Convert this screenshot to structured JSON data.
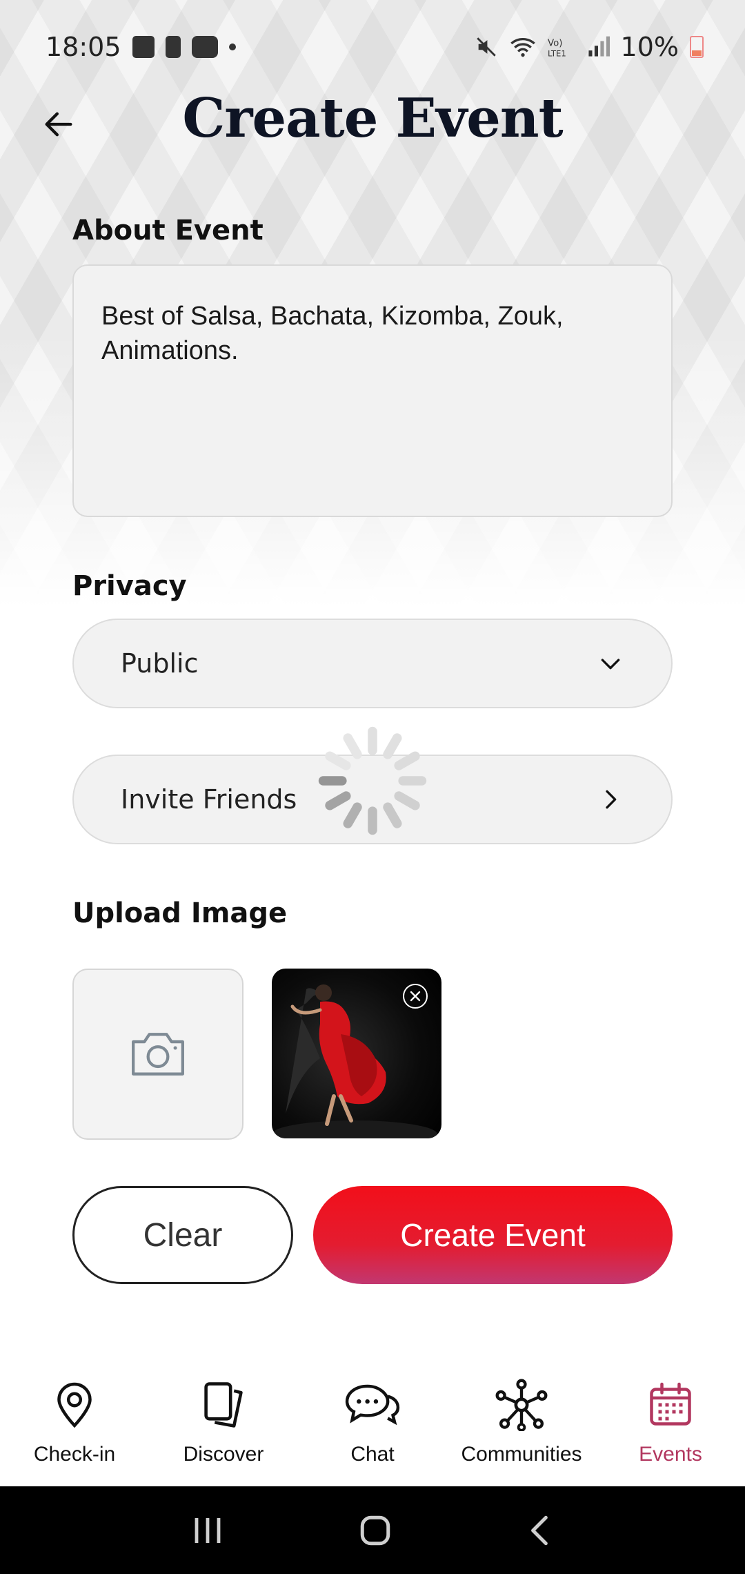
{
  "status": {
    "time": "18:05",
    "battery": "10%"
  },
  "header": {
    "title": "Create Event"
  },
  "about": {
    "label": "About Event",
    "text": "Best of Salsa, Bachata, Kizomba, Zouk, Animations."
  },
  "privacy": {
    "label": "Privacy",
    "value": "Public"
  },
  "invite": {
    "label": "Invite Friends"
  },
  "upload": {
    "label": "Upload Image"
  },
  "actions": {
    "clear": "Clear",
    "create": "Create Event"
  },
  "nav": {
    "items": [
      {
        "label": "Check-in",
        "icon": "map-pin-icon"
      },
      {
        "label": "Discover",
        "icon": "cards-icon"
      },
      {
        "label": "Chat",
        "icon": "chat-bubbles-icon"
      },
      {
        "label": "Communities",
        "icon": "network-icon"
      },
      {
        "label": "Events",
        "icon": "calendar-icon",
        "active": true
      }
    ]
  },
  "colors": {
    "accent": "#e8101e",
    "active_nav": "#b2375f"
  }
}
